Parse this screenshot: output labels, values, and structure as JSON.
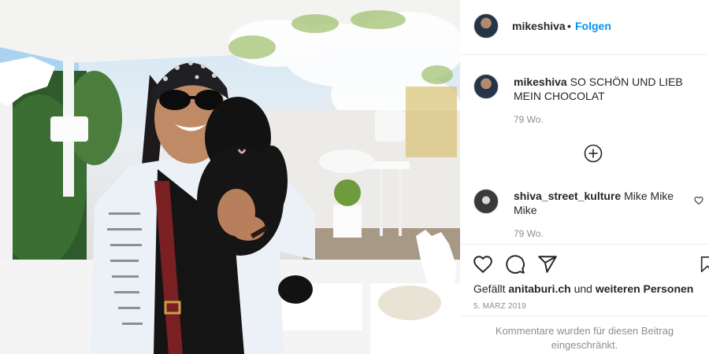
{
  "post": {
    "author": "mikeshiva",
    "follow_separator": "•",
    "follow_label": "Folgen"
  },
  "caption": {
    "username": "mikeshiva",
    "text": "SO SCHÖN UND LIEB MEIN CHOCOLAT",
    "time": "79 Wo."
  },
  "comments": [
    {
      "username": "shiva_street_kulture",
      "text": "Mike Mike Mike",
      "time": "79 Wo."
    }
  ],
  "likes": {
    "prefix": "Gefällt",
    "user": "anitaburi.ch",
    "conjunction": "und",
    "others": "weiteren Personen"
  },
  "post_date": "5. MÄRZ 2019",
  "comments_restricted_line1": "Kommentare wurden für diesen Beitrag",
  "comments_restricted_line2": "eingeschränkt.",
  "icons": {
    "like": "heart-icon",
    "comment": "comment-icon",
    "share": "share-icon",
    "save": "bookmark-icon",
    "load_more": "plus-circle-icon",
    "comment_like": "heart-icon"
  },
  "colors": {
    "follow": "#0095f6",
    "secondary_text": "#8e8e8e",
    "border": "#efefef"
  }
}
